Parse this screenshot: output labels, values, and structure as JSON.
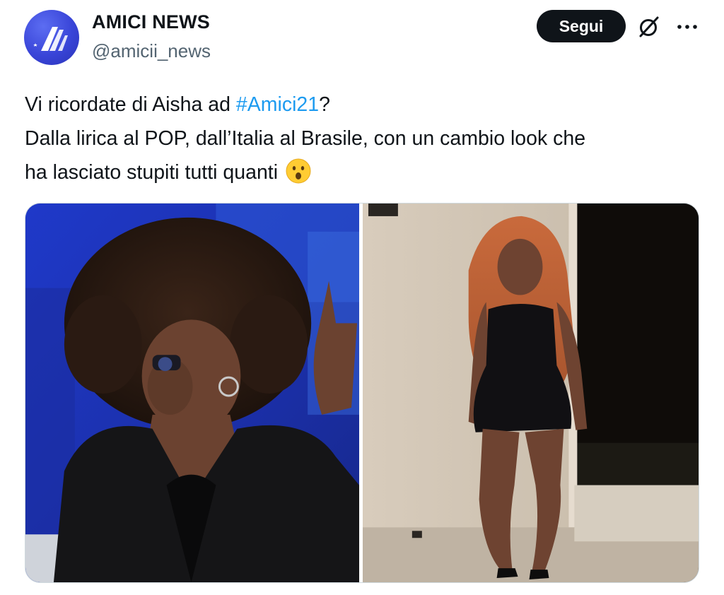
{
  "author": {
    "display_name": "AMICI NEWS",
    "handle": "@amicii_news",
    "avatar_icon": "amici-logo-icon"
  },
  "actions": {
    "follow_label": "Segui",
    "grok_icon": "grok-icon",
    "more_icon": "more-options-icon"
  },
  "tweet": {
    "line1_before": "Vi ricordate di Aisha ad ",
    "hashtag": "#Amici21",
    "line1_after": "?",
    "line2": "Dalla lirica al POP, dall’Italia al Brasile, con un cambio look che",
    "line3": "ha lasciato stupiti tutti quanti ",
    "emoji": "face-with-open-mouth-emoji"
  },
  "media": {
    "count": 2,
    "photos": [
      {
        "subject": "singer-on-stage-photo"
      },
      {
        "subject": "woman-in-black-dress-photo"
      }
    ]
  },
  "colors": {
    "text": "#0f1419",
    "secondary": "#536471",
    "link": "#1d9bf0",
    "follow_bg": "#0f1419",
    "avatar_bg": "#3945d8"
  }
}
